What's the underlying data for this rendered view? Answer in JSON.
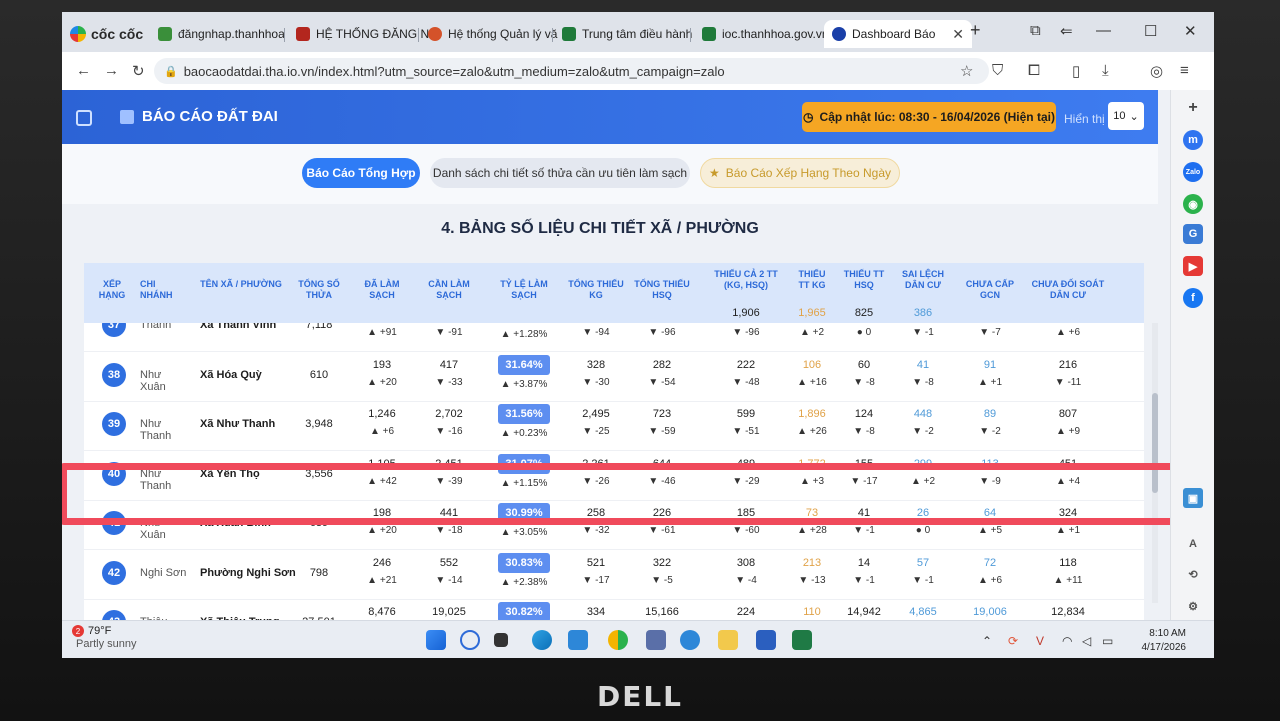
{
  "device": {
    "brand": "DELL"
  },
  "browser": {
    "logo": "cốc cốc",
    "tabs": [
      {
        "label": "đăngnhap.thanhhoa",
        "favicon_color": "#3a8f3a"
      },
      {
        "label": "HỆ THỐNG ĐĂNG N",
        "favicon_color": "#b3261e"
      },
      {
        "label": "Hệ thống Quản lý vă",
        "favicon_color": "#d4522a"
      },
      {
        "label": "Trung tâm điều hành",
        "favicon_color": "#1f7a3a"
      },
      {
        "label": "ioc.thanhhoa.gov.vn",
        "favicon_color": "#1f7a3a"
      },
      {
        "label": "Dashboard Báo",
        "favicon_color": "#1a3fa8",
        "close": "✕"
      }
    ],
    "new_tab": "+",
    "url": "baocaodatdai.tha.io.vn/index.html?utm_source=zalo&utm_medium=zalo&utm_campaign=zalo"
  },
  "header": {
    "title": "BÁO CÁO ĐẤT ĐAI",
    "update_label": "Cập nhật lúc: 08:30 - 16/04/2026 (Hiện tại)",
    "show_label": "Hiển thị",
    "show_value": "10"
  },
  "nav": {
    "tab1": "Báo Cáo Tổng Hợp",
    "tab2": "Danh sách chi tiết số thửa cần ưu tiên làm sạch",
    "tab3": "Báo Cáo Xếp Hạng Theo Ngày"
  },
  "section_title": "4. BẢNG SỐ LIỆU CHI TIẾT XÃ / PHƯỜNG",
  "table": {
    "headers": {
      "rank": "XẾP HẠNG",
      "branch": "CHI NHÁNH",
      "name": "TÊN XÃ / PHƯỜNG",
      "total": "TỔNG SỐ THỬA",
      "done": "ĐÃ LÀM SẠCH",
      "need": "CẦN LÀM SẠCH",
      "rate": "TỶ LỆ LÀM SẠCH",
      "miss_kg": "TỔNG THIẾU KG",
      "miss_hsq": "TỔNG THIẾU HSQ",
      "both": "THIẾU CẢ 2 TT (KG, HSQ)",
      "tt_kg": "THIẾU TT KG",
      "tt_hsq": "THIẾU TT HSQ",
      "dev": "SAI LỆCH DÂN CƯ",
      "gcn": "CHƯA CẤP GCN",
      "rec": "CHƯA ĐỐI SOÁT DÂN CƯ"
    },
    "header_totals": {
      "both": "1,906",
      "tt_kg": "1,965",
      "tt_hsq": "825",
      "dev": "386"
    },
    "rows": [
      {
        "rank": "37",
        "branch": "Thành",
        "name": "Xã Thành Vinh",
        "total": "7,118",
        "done": "",
        "done_d": "▲ +91",
        "need": "",
        "need_d": "▼ -91",
        "rate": "",
        "rate_d": "▲ +1.28%",
        "kg": "",
        "kg_d": "▼ -94",
        "hsq": "",
        "hsq_d": "▼ -96",
        "both": "",
        "both_d": "▼ -96",
        "ttkg": "",
        "ttkg_d": "▲ +2",
        "tthsq": "",
        "tthsq_d": "● 0",
        "dev": "",
        "dev_d": "▼ -1",
        "gcn": "",
        "gcn_d": "▼ -7",
        "rec": "",
        "rec_d": "▲ +6"
      },
      {
        "rank": "38",
        "branch": "Như Xuân",
        "name": "Xã Hóa Quỳ",
        "total": "610",
        "done": "193",
        "done_d": "▲ +20",
        "need": "417",
        "need_d": "▼ -33",
        "rate": "31.64%",
        "rate_d": "▲ +3.87%",
        "kg": "328",
        "kg_d": "▼ -30",
        "hsq": "282",
        "hsq_d": "▼ -54",
        "both": "222",
        "both_d": "▼ -48",
        "ttkg": "106",
        "ttkg_d": "▲ +16",
        "tthsq": "60",
        "tthsq_d": "▼ -8",
        "dev": "41",
        "dev_d": "▼ -8",
        "gcn": "91",
        "gcn_d": "▲ +1",
        "rec": "216",
        "rec_d": "▼ -11"
      },
      {
        "rank": "39",
        "branch": "Như Thanh",
        "name": "Xã Như Thanh",
        "total": "3,948",
        "done": "1,246",
        "done_d": "▲ +6",
        "need": "2,702",
        "need_d": "▼ -16",
        "rate": "31.56%",
        "rate_d": "▲ +0.23%",
        "kg": "2,495",
        "kg_d": "▼ -25",
        "hsq": "723",
        "hsq_d": "▼ -59",
        "both": "599",
        "both_d": "▼ -51",
        "ttkg": "1,896",
        "ttkg_d": "▲ +26",
        "tthsq": "124",
        "tthsq_d": "▼ -8",
        "dev": "448",
        "dev_d": "▼ -2",
        "gcn": "89",
        "gcn_d": "▼ -2",
        "rec": "807",
        "rec_d": "▲ +9"
      },
      {
        "rank": "40",
        "branch": "Như Thanh",
        "name": "Xã Yên Thọ",
        "total": "3,556",
        "done": "1,105",
        "done_d": "▲ +42",
        "need": "2,451",
        "need_d": "▼ -39",
        "rate": "31.07%",
        "rate_d": "▲ +1.15%",
        "kg": "2,261",
        "kg_d": "▼ -26",
        "hsq": "644",
        "hsq_d": "▼ -46",
        "both": "489",
        "both_d": "▼ -29",
        "ttkg": "1,772",
        "ttkg_d": "▲ +3",
        "tthsq": "155",
        "tthsq_d": "▼ -17",
        "dev": "299",
        "dev_d": "▲ +2",
        "gcn": "113",
        "gcn_d": "▼ -9",
        "rec": "451",
        "rec_d": "▲ +4"
      },
      {
        "rank": "41",
        "branch": "Như Xuân",
        "name": "Xã Xuân Bình",
        "total": "639",
        "done": "198",
        "done_d": "▲ +20",
        "need": "441",
        "need_d": "▼ -18",
        "rate": "30.99%",
        "rate_d": "▲ +3.05%",
        "kg": "258",
        "kg_d": "▼ -32",
        "hsq": "226",
        "hsq_d": "▼ -61",
        "both": "185",
        "both_d": "▼ -60",
        "ttkg": "73",
        "ttkg_d": "▲ +28",
        "tthsq": "41",
        "tthsq_d": "▼ -1",
        "dev": "26",
        "dev_d": "● 0",
        "gcn": "64",
        "gcn_d": "▲ +5",
        "rec": "324",
        "rec_d": "▲ +1"
      },
      {
        "rank": "42",
        "branch": "Nghi Sơn",
        "name": "Phường Nghi Sơn",
        "total": "798",
        "done": "246",
        "done_d": "▲ +21",
        "need": "552",
        "need_d": "▼ -14",
        "rate": "30.83%",
        "rate_d": "▲ +2.38%",
        "kg": "521",
        "kg_d": "▼ -17",
        "hsq": "322",
        "hsq_d": "▼ -5",
        "both": "308",
        "both_d": "▼ -4",
        "ttkg": "213",
        "ttkg_d": "▼ -13",
        "tthsq": "14",
        "tthsq_d": "▼ -1",
        "dev": "57",
        "dev_d": "▼ -1",
        "gcn": "72",
        "gcn_d": "▲ +6",
        "rec": "118",
        "rec_d": "▲ +11"
      },
      {
        "rank": "43",
        "branch": "Thiệu Hóa",
        "name": "Xã Thiệu Trung",
        "total": "27,501",
        "done": "8,476",
        "done_d": "",
        "need": "19,025",
        "need_d": "",
        "rate": "30.82%",
        "rate_d": "",
        "kg": "334",
        "kg_d": "",
        "hsq": "15,166",
        "hsq_d": "",
        "both": "224",
        "both_d": "",
        "ttkg": "110",
        "ttkg_d": "",
        "tthsq": "14,942",
        "tthsq_d": "",
        "dev": "4,865",
        "dev_d": "",
        "gcn": "19,006",
        "gcn_d": "",
        "rec": "12,834",
        "rec_d": ""
      }
    ]
  },
  "taskbar": {
    "weather_temp": "79°F",
    "weather_desc": "Partly sunny",
    "weather_badge": "2",
    "time": "8:10 AM",
    "date": "4/17/2026"
  }
}
